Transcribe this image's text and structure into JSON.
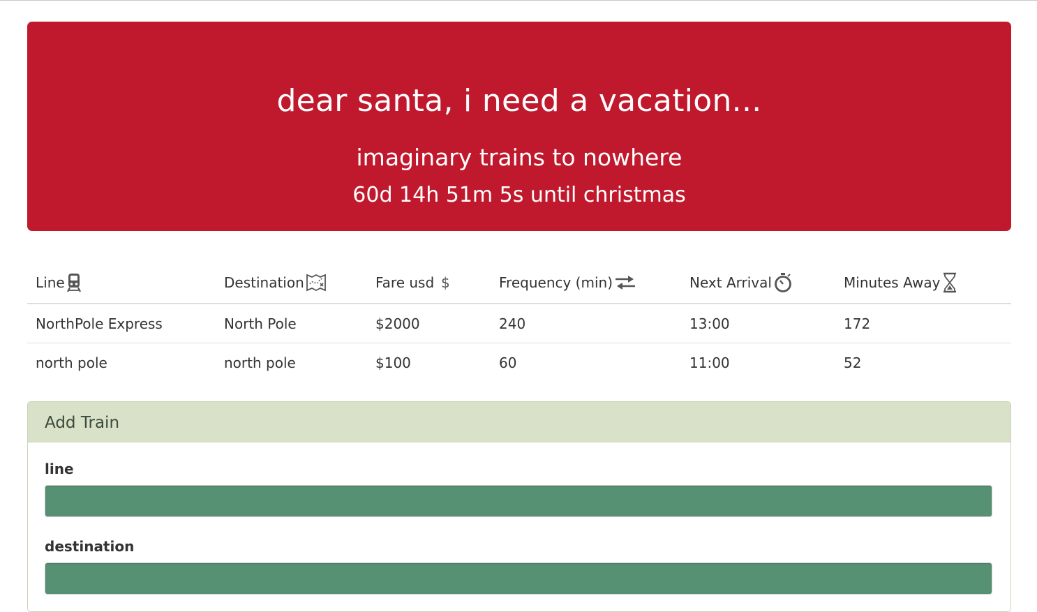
{
  "header": {
    "title": "dear santa, i need a vacation...",
    "subtitle": "imaginary trains to nowhere",
    "countdown": "60d 14h 51m 5s until christmas",
    "background_color": "#c0192d"
  },
  "table": {
    "columns": [
      {
        "label": "Line",
        "icon": "train-icon"
      },
      {
        "label": "Destination",
        "icon": "map-icon"
      },
      {
        "label": "Fare usd",
        "icon": "dollar-icon"
      },
      {
        "label": "Frequency (min)",
        "icon": "transfer-arrows-icon"
      },
      {
        "label": "Next Arrival",
        "icon": "stopwatch-icon"
      },
      {
        "label": "Minutes Away",
        "icon": "hourglass-icon"
      }
    ],
    "rows": [
      {
        "line": "NorthPole Express",
        "destination": "North Pole",
        "fare": "$2000",
        "frequency": "240",
        "next_arrival": "13:00",
        "minutes_away": "172"
      },
      {
        "line": "north pole",
        "destination": "north pole",
        "fare": "$100",
        "frequency": "60",
        "next_arrival": "11:00",
        "minutes_away": "52"
      }
    ]
  },
  "add_train": {
    "heading": "Add Train",
    "fields": [
      {
        "label": "line",
        "value": ""
      },
      {
        "label": "destination",
        "value": ""
      }
    ],
    "heading_color": "#d9e2c8",
    "input_color": "#579174"
  }
}
